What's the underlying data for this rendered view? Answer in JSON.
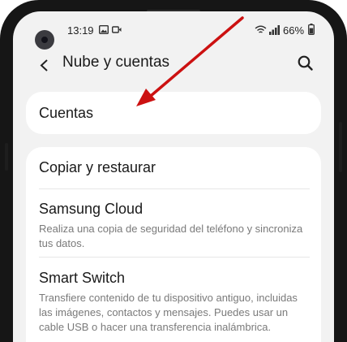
{
  "status_bar": {
    "time": "13:19",
    "battery": "66%",
    "icons": [
      "image-icon",
      "video-icon",
      "wifi-icon",
      "signal-icon",
      "battery-icon"
    ]
  },
  "header": {
    "title": "Nube y cuentas",
    "back_icon": "back-arrow-icon",
    "search_icon": "search-icon"
  },
  "items": [
    {
      "title": "Cuentas",
      "description": ""
    },
    {
      "title": "Copiar y restaurar",
      "description": ""
    },
    {
      "title": "Samsung Cloud",
      "description": "Realiza una copia de seguridad del teléfono y sincroniza tus datos."
    },
    {
      "title": "Smart Switch",
      "description": "Transfiere contenido de tu dispositivo antiguo, incluidas las imágenes, contactos y mensajes. Puedes usar un cable USB o hacer una transferencia inalámbrica."
    }
  ],
  "annotation": {
    "arrow_color": "#cc1111"
  }
}
